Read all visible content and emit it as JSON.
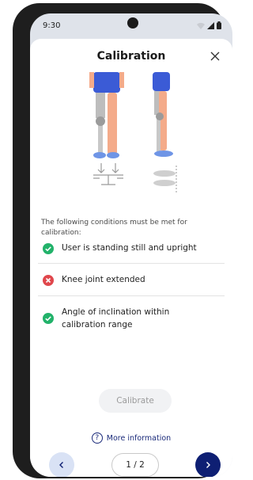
{
  "status_bar": {
    "time": "9:30",
    "icons": [
      "wifi-icon",
      "signal-icon",
      "battery-icon"
    ]
  },
  "dialog": {
    "title": "Calibration",
    "close_icon": "close-icon",
    "intro": "The following conditions must be met for calibration:",
    "conditions": [
      {
        "label": "User is standing still and upright",
        "status": "ok",
        "icon": "check-circle-icon"
      },
      {
        "label": "Knee joint extended",
        "status": "error",
        "icon": "x-circle-icon"
      },
      {
        "label": "Angle of inclination within calibration range",
        "status": "ok",
        "icon": "check-circle-icon"
      }
    ],
    "calibrate_label": "Calibrate",
    "more_info_label": "More information",
    "pager_label": "1 / 2"
  },
  "colors": {
    "ok": "#22b26a",
    "error": "#e0474c",
    "primary": "#0e1f73",
    "secondary": "#d9e2f5",
    "shorts": "#3b5bd6",
    "shoes": "#6f95e6",
    "skin": "#f4ab8a",
    "prosthesis": "#bdbdbd"
  }
}
